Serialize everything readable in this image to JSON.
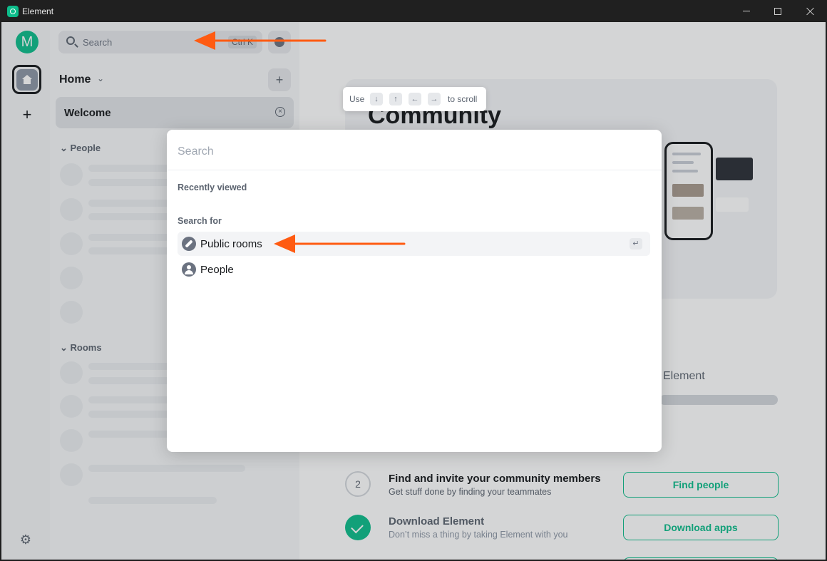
{
  "window": {
    "title": "Element",
    "controls": {
      "minimize": "minimize-icon",
      "maximize": "maximize-icon",
      "close": "close-icon"
    }
  },
  "spaces": {
    "avatar_letter": "M",
    "home_icon": "home-icon",
    "add_icon": "+",
    "settings_icon": "⚙"
  },
  "roomlist": {
    "search_label": "Search",
    "search_shortcut": "Ctrl K",
    "home_title": "Home",
    "home_chevron": "⌄",
    "add_label": "+",
    "welcome_label": "Welcome",
    "welcome_close": "×",
    "sections": {
      "people": "People",
      "rooms": "Rooms"
    }
  },
  "main": {
    "hero_title": "Community",
    "element_label": "Element",
    "steps": [
      {
        "number": "2",
        "title": "Find and invite your community members",
        "subtitle": "Get stuff done by finding your teammates",
        "button": "Find people"
      },
      {
        "title": "Download Element",
        "subtitle": "Don’t miss a thing by taking Element with you",
        "button": "Download apps",
        "done": true
      }
    ]
  },
  "scroll_hint": {
    "prefix": "Use",
    "keys": [
      "↓",
      "↑",
      "←",
      "→"
    ],
    "suffix": "to scroll"
  },
  "dialog": {
    "search_placeholder": "Search",
    "recently_viewed": "Recently viewed",
    "search_for": "Search for",
    "options": [
      {
        "label": "Public rooms",
        "icon": "compass-icon",
        "selected": true,
        "enter_glyph": "↵"
      },
      {
        "label": "People",
        "icon": "person-icon",
        "selected": false
      }
    ]
  },
  "colors": {
    "accent": "#0dbd8b",
    "annotation_arrow": "#ff5b12",
    "text_primary": "#17191c",
    "text_secondary": "#5c6470"
  }
}
